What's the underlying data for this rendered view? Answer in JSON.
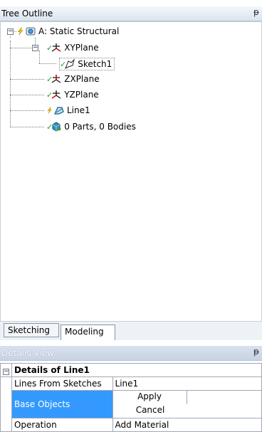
{
  "tree_outline": {
    "title": "Tree Outline",
    "pin_glyph": "ᵽ",
    "nodes": [
      {
        "label": "A: Static Structural",
        "icon": "static-structural-icon"
      },
      {
        "label": "XYPlane",
        "icon": "plane-axes-icon"
      },
      {
        "label": "Sketch1",
        "icon": "sketch-icon"
      },
      {
        "label": "ZXPlane",
        "icon": "plane-axes-icon"
      },
      {
        "label": "YZPlane",
        "icon": "plane-axes-icon"
      },
      {
        "label": "Line1",
        "icon": "line-body-icon"
      },
      {
        "label": "0 Parts, 0 Bodies",
        "icon": "parts-icon"
      }
    ]
  },
  "tabs": [
    {
      "label": "Sketching",
      "active": false
    },
    {
      "label": "Modeling",
      "active": true
    }
  ],
  "details_view": {
    "title": "Details View",
    "pin_glyph": "ᵽ",
    "group_title": "Details of Line1",
    "rows": [
      {
        "name": "Lines From Sketches",
        "value": "Line1"
      },
      {
        "name": "Base Objects",
        "apply": "Apply",
        "cancel": "Cancel"
      },
      {
        "name": "Operation",
        "value": "Add Material"
      }
    ]
  },
  "colors": {
    "selected_row": "#3399ff",
    "check_green": "#21a021"
  }
}
